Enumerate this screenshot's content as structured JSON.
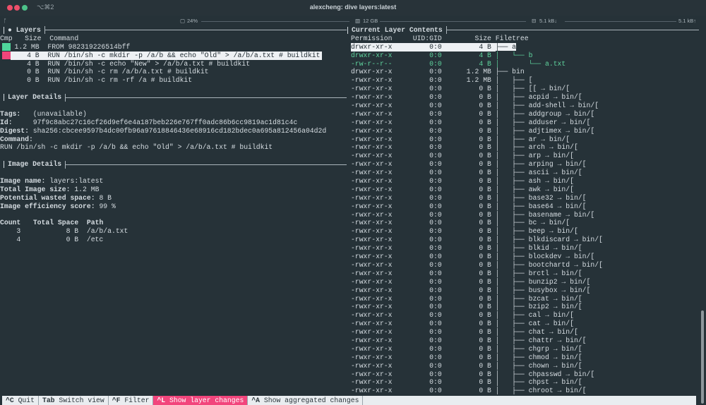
{
  "window": {
    "title": "alexcheng: dive layers:latest",
    "shortcut": "⌥⌘2",
    "traffic_lights": [
      "#ee4f6a",
      "#ee4f6a",
      "#4cc38a"
    ]
  },
  "status_bar": {
    "branch_icon": "ᚩ",
    "cpu": "24%",
    "memory": "12 GB",
    "net_down": "5.1 kB↓",
    "net_up": "5.1 kB↑"
  },
  "layers": {
    "title": "Layers",
    "headers": {
      "cmp": "Cmp",
      "size": "Size",
      "command": "Command"
    },
    "rows": [
      {
        "size": "1.2 MB",
        "command": "FROM 982319226514bff",
        "cmp_color": "#4fd69c",
        "selected": false
      },
      {
        "size": "4 B",
        "command": "RUN /bin/sh -c mkdir -p /a/b && echo \"Old\" > /a/b/a.txt # buildkit",
        "cmp_color": "#f0457a",
        "selected": true
      },
      {
        "size": "4 B",
        "command": "RUN /bin/sh -c echo \"New\" > /a/b/a.txt # buildkit",
        "cmp_color": "",
        "selected": false
      },
      {
        "size": "0 B",
        "command": "RUN /bin/sh -c rm /a/b/a.txt # buildkit",
        "cmp_color": "",
        "selected": false
      },
      {
        "size": "0 B",
        "command": "RUN /bin/sh -c rm -rf /a # buildkit",
        "cmp_color": "",
        "selected": false
      }
    ]
  },
  "layer_details": {
    "title": "Layer Details",
    "tags_label": "Tags:",
    "tags": "(unavailable)",
    "id_label": "Id:",
    "id": "97f9c8abc27c16cf26d9ef6e4a187beb226e767ff0adc86b6cc9819ac1d81c4c",
    "digest_label": "Digest:",
    "digest": "sha256:cbcee9597b4dc00fb96a97618846436e68916cd182bdec0a695a812456a04d2d",
    "command_label": "Command:",
    "command": "RUN /bin/sh -c mkdir -p /a/b && echo \"Old\" > /a/b/a.txt # buildkit"
  },
  "image_details": {
    "title": "Image Details",
    "name_label": "Image name:",
    "name": "layers:latest",
    "size_label": "Total Image size:",
    "size": "1.2 MB",
    "wasted_label": "Potential wasted space:",
    "wasted": "8 B",
    "efficiency_label": "Image efficiency score:",
    "efficiency": "99 %",
    "table_headers": {
      "count": "Count",
      "space": "Total Space",
      "path": "Path"
    },
    "table_rows": [
      {
        "count": "3",
        "space": "8 B",
        "path": "/a/b/a.txt"
      },
      {
        "count": "4",
        "space": "0 B",
        "path": "/etc"
      }
    ]
  },
  "contents": {
    "title": "Current Layer Contents",
    "headers": {
      "permission": "Permission",
      "uid": "UID:GID",
      "size": "Size",
      "tree": "Filetree"
    },
    "added_color": "#5fd39d",
    "rows": [
      {
        "perm": "drwxr-xr-x",
        "uid": "0:0",
        "size": "4 B",
        "tree": "├── a",
        "state": "selected"
      },
      {
        "perm": "drwxr-xr-x",
        "uid": "0:0",
        "size": "4 B",
        "tree": "│   └── b",
        "state": "added"
      },
      {
        "perm": "-rw-r--r--",
        "uid": "0:0",
        "size": "4 B",
        "tree": "│       └── a.txt",
        "state": "added"
      },
      {
        "perm": "drwxr-xr-x",
        "uid": "0:0",
        "size": "1.2 MB",
        "tree": "├── bin",
        "state": ""
      },
      {
        "perm": "-rwxr-xr-x",
        "uid": "0:0",
        "size": "1.2 MB",
        "tree": "│   ├── [",
        "state": ""
      },
      {
        "perm": "-rwxr-xr-x",
        "uid": "0:0",
        "size": "0 B",
        "tree": "│   ├── [[ → bin/[",
        "state": ""
      },
      {
        "perm": "-rwxr-xr-x",
        "uid": "0:0",
        "size": "0 B",
        "tree": "│   ├── acpid → bin/[",
        "state": ""
      },
      {
        "perm": "-rwxr-xr-x",
        "uid": "0:0",
        "size": "0 B",
        "tree": "│   ├── add-shell → bin/[",
        "state": ""
      },
      {
        "perm": "-rwxr-xr-x",
        "uid": "0:0",
        "size": "0 B",
        "tree": "│   ├── addgroup → bin/[",
        "state": ""
      },
      {
        "perm": "-rwxr-xr-x",
        "uid": "0:0",
        "size": "0 B",
        "tree": "│   ├── adduser → bin/[",
        "state": ""
      },
      {
        "perm": "-rwxr-xr-x",
        "uid": "0:0",
        "size": "0 B",
        "tree": "│   ├── adjtimex → bin/[",
        "state": ""
      },
      {
        "perm": "-rwxr-xr-x",
        "uid": "0:0",
        "size": "0 B",
        "tree": "│   ├── ar → bin/[",
        "state": ""
      },
      {
        "perm": "-rwxr-xr-x",
        "uid": "0:0",
        "size": "0 B",
        "tree": "│   ├── arch → bin/[",
        "state": ""
      },
      {
        "perm": "-rwxr-xr-x",
        "uid": "0:0",
        "size": "0 B",
        "tree": "│   ├── arp → bin/[",
        "state": ""
      },
      {
        "perm": "-rwxr-xr-x",
        "uid": "0:0",
        "size": "0 B",
        "tree": "│   ├── arping → bin/[",
        "state": ""
      },
      {
        "perm": "-rwxr-xr-x",
        "uid": "0:0",
        "size": "0 B",
        "tree": "│   ├── ascii → bin/[",
        "state": ""
      },
      {
        "perm": "-rwxr-xr-x",
        "uid": "0:0",
        "size": "0 B",
        "tree": "│   ├── ash → bin/[",
        "state": ""
      },
      {
        "perm": "-rwxr-xr-x",
        "uid": "0:0",
        "size": "0 B",
        "tree": "│   ├── awk → bin/[",
        "state": ""
      },
      {
        "perm": "-rwxr-xr-x",
        "uid": "0:0",
        "size": "0 B",
        "tree": "│   ├── base32 → bin/[",
        "state": ""
      },
      {
        "perm": "-rwxr-xr-x",
        "uid": "0:0",
        "size": "0 B",
        "tree": "│   ├── base64 → bin/[",
        "state": ""
      },
      {
        "perm": "-rwxr-xr-x",
        "uid": "0:0",
        "size": "0 B",
        "tree": "│   ├── basename → bin/[",
        "state": ""
      },
      {
        "perm": "-rwxr-xr-x",
        "uid": "0:0",
        "size": "0 B",
        "tree": "│   ├── bc → bin/[",
        "state": ""
      },
      {
        "perm": "-rwxr-xr-x",
        "uid": "0:0",
        "size": "0 B",
        "tree": "│   ├── beep → bin/[",
        "state": ""
      },
      {
        "perm": "-rwxr-xr-x",
        "uid": "0:0",
        "size": "0 B",
        "tree": "│   ├── blkdiscard → bin/[",
        "state": ""
      },
      {
        "perm": "-rwxr-xr-x",
        "uid": "0:0",
        "size": "0 B",
        "tree": "│   ├── blkid → bin/[",
        "state": ""
      },
      {
        "perm": "-rwxr-xr-x",
        "uid": "0:0",
        "size": "0 B",
        "tree": "│   ├── blockdev → bin/[",
        "state": ""
      },
      {
        "perm": "-rwxr-xr-x",
        "uid": "0:0",
        "size": "0 B",
        "tree": "│   ├── bootchartd → bin/[",
        "state": ""
      },
      {
        "perm": "-rwxr-xr-x",
        "uid": "0:0",
        "size": "0 B",
        "tree": "│   ├── brctl → bin/[",
        "state": ""
      },
      {
        "perm": "-rwxr-xr-x",
        "uid": "0:0",
        "size": "0 B",
        "tree": "│   ├── bunzip2 → bin/[",
        "state": ""
      },
      {
        "perm": "-rwxr-xr-x",
        "uid": "0:0",
        "size": "0 B",
        "tree": "│   ├── busybox → bin/[",
        "state": ""
      },
      {
        "perm": "-rwxr-xr-x",
        "uid": "0:0",
        "size": "0 B",
        "tree": "│   ├── bzcat → bin/[",
        "state": ""
      },
      {
        "perm": "-rwxr-xr-x",
        "uid": "0:0",
        "size": "0 B",
        "tree": "│   ├── bzip2 → bin/[",
        "state": ""
      },
      {
        "perm": "-rwxr-xr-x",
        "uid": "0:0",
        "size": "0 B",
        "tree": "│   ├── cal → bin/[",
        "state": ""
      },
      {
        "perm": "-rwxr-xr-x",
        "uid": "0:0",
        "size": "0 B",
        "tree": "│   ├── cat → bin/[",
        "state": ""
      },
      {
        "perm": "-rwxr-xr-x",
        "uid": "0:0",
        "size": "0 B",
        "tree": "│   ├── chat → bin/[",
        "state": ""
      },
      {
        "perm": "-rwxr-xr-x",
        "uid": "0:0",
        "size": "0 B",
        "tree": "│   ├── chattr → bin/[",
        "state": ""
      },
      {
        "perm": "-rwxr-xr-x",
        "uid": "0:0",
        "size": "0 B",
        "tree": "│   ├── chgrp → bin/[",
        "state": ""
      },
      {
        "perm": "-rwxr-xr-x",
        "uid": "0:0",
        "size": "0 B",
        "tree": "│   ├── chmod → bin/[",
        "state": ""
      },
      {
        "perm": "-rwxr-xr-x",
        "uid": "0:0",
        "size": "0 B",
        "tree": "│   ├── chown → bin/[",
        "state": ""
      },
      {
        "perm": "-rwxr-xr-x",
        "uid": "0:0",
        "size": "0 B",
        "tree": "│   ├── chpasswd → bin/[",
        "state": ""
      },
      {
        "perm": "-rwxr-xr-x",
        "uid": "0:0",
        "size": "0 B",
        "tree": "│   ├── chpst → bin/[",
        "state": ""
      },
      {
        "perm": "-rwxr-xr-x",
        "uid": "0:0",
        "size": "0 B",
        "tree": "│   ├── chroot → bin/[",
        "state": ""
      }
    ]
  },
  "footer": {
    "items": [
      {
        "key": "^C",
        "label": "Quit",
        "active": false
      },
      {
        "key": "Tab",
        "label": "Switch view",
        "active": false
      },
      {
        "key": "^F",
        "label": "Filter",
        "active": false
      },
      {
        "key": "^L",
        "label": "Show layer changes",
        "active": true
      },
      {
        "key": "^A",
        "label": "Show aggregated changes",
        "active": false
      }
    ],
    "active_color": "#f2457c"
  }
}
